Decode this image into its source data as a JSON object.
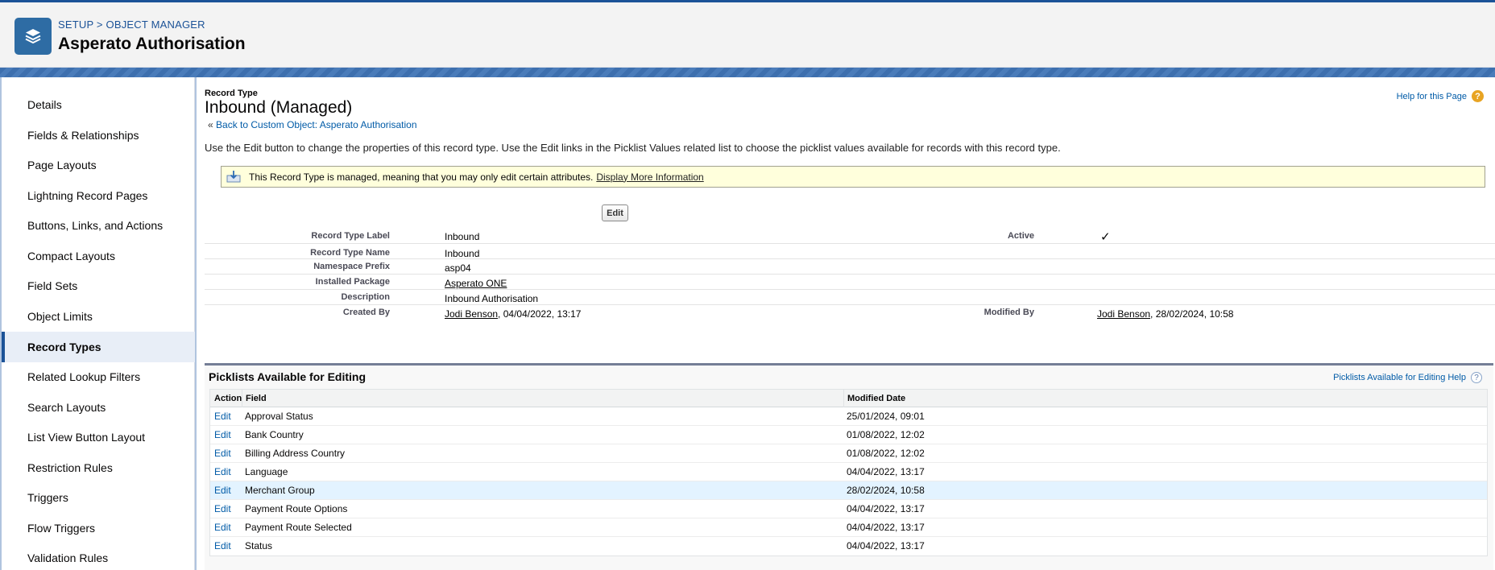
{
  "header": {
    "breadcrumb_setup": "SETUP",
    "breadcrumb_sep": ">",
    "breadcrumb_object_manager": "OBJECT MANAGER",
    "title": "Asperato Authorisation",
    "icon": "layers-icon"
  },
  "sidebar": {
    "items": [
      {
        "label": "Details"
      },
      {
        "label": "Fields & Relationships"
      },
      {
        "label": "Page Layouts"
      },
      {
        "label": "Lightning Record Pages"
      },
      {
        "label": "Buttons, Links, and Actions"
      },
      {
        "label": "Compact Layouts"
      },
      {
        "label": "Field Sets"
      },
      {
        "label": "Object Limits"
      },
      {
        "label": "Record Types"
      },
      {
        "label": "Related Lookup Filters"
      },
      {
        "label": "Search Layouts"
      },
      {
        "label": "List View Button Layout"
      },
      {
        "label": "Restriction Rules"
      },
      {
        "label": "Triggers"
      },
      {
        "label": "Flow Triggers"
      },
      {
        "label": "Validation Rules"
      }
    ],
    "active": "Record Types"
  },
  "main": {
    "record_type_label": "Record Type",
    "title": "Inbound (Managed)",
    "back_prefix": "«",
    "back_link": "Back to Custom Object: Asperato Authorisation",
    "help_link": "Help for this Page",
    "intro": "Use the Edit button to change the properties of this record type. Use the Edit links in the Picklist Values related list to choose the picklist values available for records with this record type.",
    "notice_text": "This Record Type is managed, meaning that you may only edit certain attributes.",
    "notice_link": "Display More Information",
    "edit_button": "Edit"
  },
  "details": {
    "record_type_label_label": "Record Type Label",
    "record_type_label_value": "Inbound",
    "active_label": "Active",
    "active_value": "✓",
    "record_type_name_label": "Record Type Name",
    "record_type_name_value": "Inbound",
    "namespace_prefix_label": "Namespace Prefix",
    "namespace_prefix_value": "asp04",
    "installed_package_label": "Installed Package",
    "installed_package_value": "Asperato ONE",
    "description_label": "Description",
    "description_value": "Inbound Authorisation",
    "created_by_label": "Created By",
    "created_by_user": "Jodi Benson",
    "created_by_date": ", 04/04/2022, 13:17",
    "modified_by_label": "Modified By",
    "modified_by_user": "Jodi Benson",
    "modified_by_date": ", 28/02/2024, 10:58"
  },
  "picklists": {
    "title": "Picklists Available for Editing",
    "help_link": "Picklists Available for Editing Help",
    "columns": {
      "action": "Action",
      "field": "Field",
      "modified_date": "Modified Date"
    },
    "rows": [
      {
        "action": "Edit",
        "field": "Approval Status",
        "date": "25/01/2024, 09:01"
      },
      {
        "action": "Edit",
        "field": "Bank Country",
        "date": "01/08/2022, 12:02"
      },
      {
        "action": "Edit",
        "field": "Billing Address Country",
        "date": "01/08/2022, 12:02"
      },
      {
        "action": "Edit",
        "field": "Language",
        "date": "04/04/2022, 13:17"
      },
      {
        "action": "Edit",
        "field": "Merchant Group",
        "date": "28/02/2024, 10:58"
      },
      {
        "action": "Edit",
        "field": "Payment Route Options",
        "date": "04/04/2022, 13:17"
      },
      {
        "action": "Edit",
        "field": "Payment Route Selected",
        "date": "04/04/2022, 13:17"
      },
      {
        "action": "Edit",
        "field": "Status",
        "date": "04/04/2022, 13:17"
      }
    ]
  }
}
